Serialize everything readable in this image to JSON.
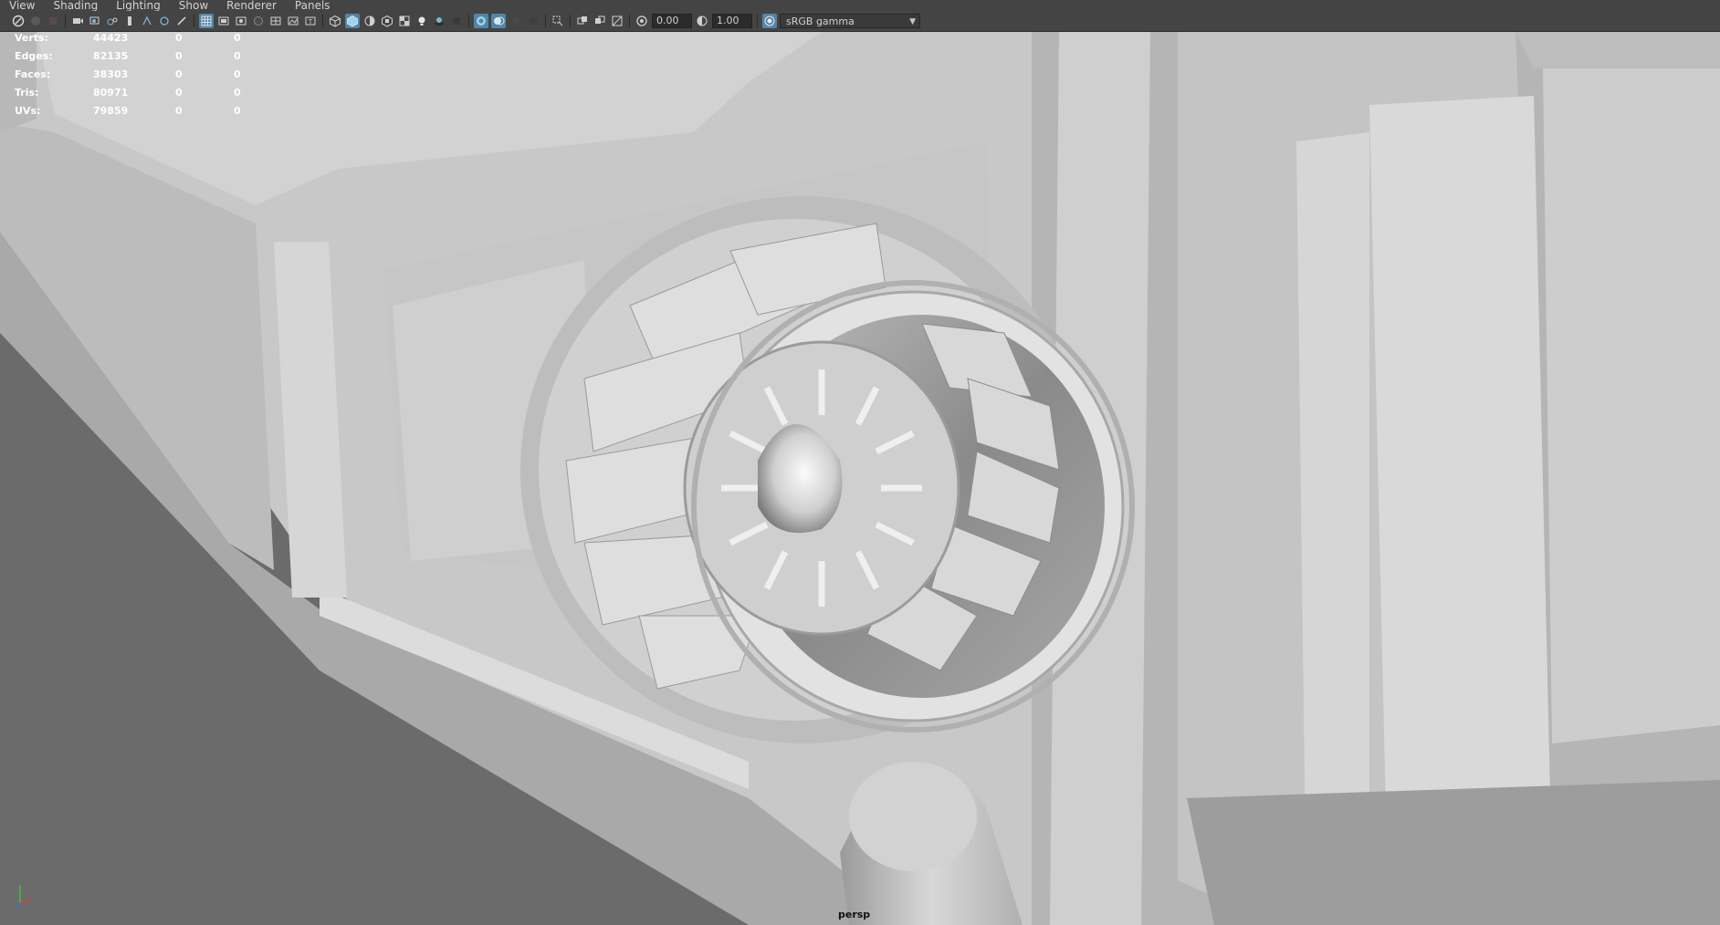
{
  "menubar": {
    "items": [
      "View",
      "Shading",
      "Lighting",
      "Show",
      "Renderer",
      "Panels"
    ]
  },
  "toolbar": {
    "exposure_value": "0.00",
    "gamma_value": "1.00",
    "color_space": "sRGB gamma",
    "icons": [
      "select-camera-icon",
      "camera-attributes-icon",
      "bookmark-icon",
      "image-plane-icon",
      "two-d-pan-zoom-icon",
      "grease-pencil-icon",
      "grid-icon",
      "film-gate-icon",
      "resolution-gate-icon",
      "gate-mask-icon",
      "field-chart-icon",
      "safe-action-icon",
      "safe-title-icon",
      "wireframe-icon",
      "smooth-shade-icon",
      "default-material-icon",
      "textured-icon",
      "use-all-lights-icon",
      "shadows-icon",
      "screen-space-ao-icon",
      "motion-blur-icon",
      "multisample-aa-icon",
      "depth-of-field-icon",
      "isolate-select-icon",
      "xray-icon",
      "xray-joints-icon",
      "backface-culling-icon",
      "exposure-icon",
      "gamma-icon",
      "color-management-icon"
    ]
  },
  "hud": {
    "rows": [
      {
        "label": "Verts:",
        "v1": "44423",
        "v2": "0",
        "v3": "0"
      },
      {
        "label": "Edges:",
        "v1": "82135",
        "v2": "0",
        "v3": "0"
      },
      {
        "label": "Faces:",
        "v1": "38303",
        "v2": "0",
        "v3": "0"
      },
      {
        "label": "Tris:",
        "v1": "80971",
        "v2": "0",
        "v3": "0"
      },
      {
        "label": "UVs:",
        "v1": "79859",
        "v2": "0",
        "v3": "0"
      }
    ]
  },
  "viewport": {
    "camera": "persp",
    "background_color": "#6b6b6b"
  }
}
